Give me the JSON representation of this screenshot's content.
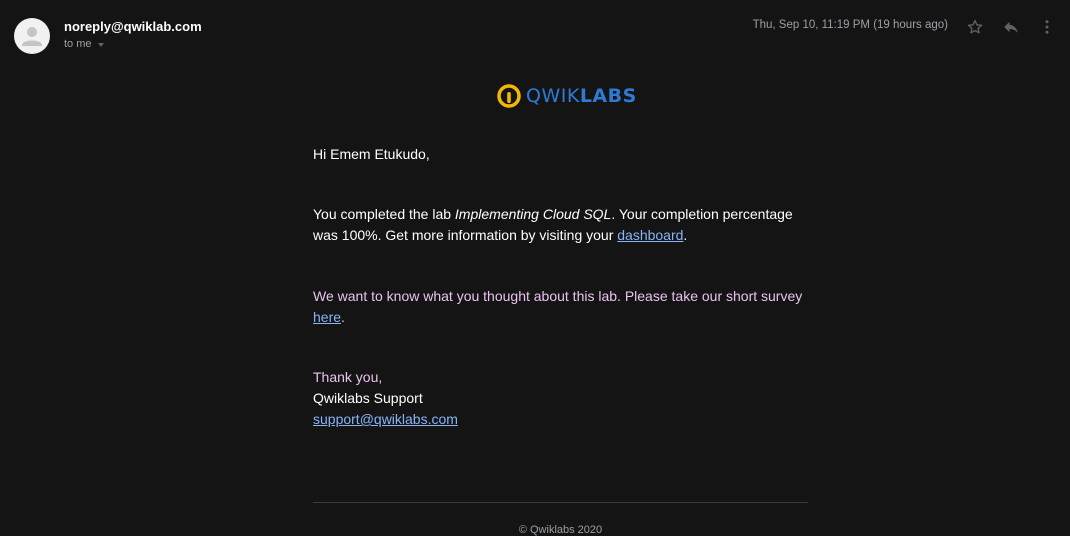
{
  "header": {
    "sender": "noreply@qwiklab.com",
    "recipient": "to me",
    "timestamp": "Thu, Sep 10, 11:19 PM (19 hours ago)",
    "icons": [
      "avatar-icon",
      "star-icon",
      "reply-icon",
      "more-vert-icon"
    ]
  },
  "logo": {
    "text_light": "QWIK",
    "text_bold": "LABS",
    "ring_color": "#f5b800",
    "text_color": "#2e7bd6"
  },
  "email": {
    "greeting": "Hi Emem Etukudo,",
    "completion": {
      "prefix": "You completed the lab ",
      "lab_name": "Implementing Cloud SQL",
      "middle": ". Your completion percentage was 100%. Get more information by visiting your ",
      "link_text": "dashboard",
      "suffix": "."
    },
    "survey": {
      "prefix": "We want to know what you thought about this lab. Please take our short survey ",
      "link_text": "here",
      "suffix": "."
    },
    "signoff": {
      "thanks": "Thank you,",
      "team": "Qwiklabs Support",
      "email": "support@qwiklabs.com"
    }
  },
  "footer": {
    "copyright": "© Qwiklabs 2020"
  },
  "colors": {
    "background": "#141414",
    "link": "#8ab4f8",
    "pink_text": "#e9c2ef"
  }
}
